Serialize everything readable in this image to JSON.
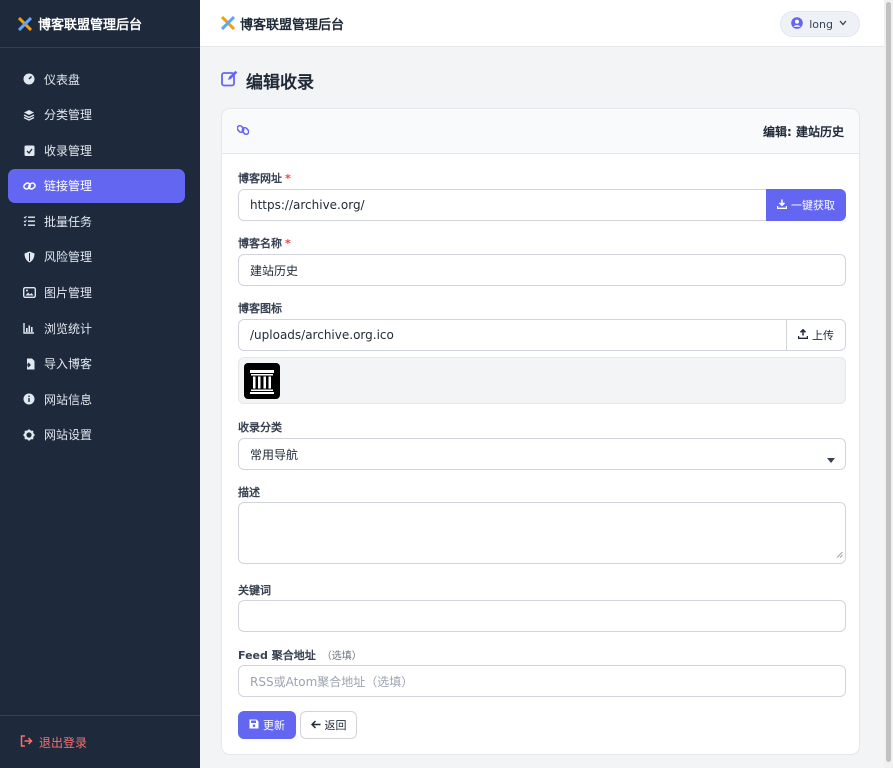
{
  "sidebar": {
    "brand": "博客联盟管理后台",
    "items": [
      {
        "label": "仪表盘",
        "icon": "gauge-icon"
      },
      {
        "label": "分类管理",
        "icon": "layers-icon"
      },
      {
        "label": "收录管理",
        "icon": "clipboard-check-icon"
      },
      {
        "label": "链接管理",
        "icon": "link-icon",
        "active": true
      },
      {
        "label": "批量任务",
        "icon": "list-check-icon"
      },
      {
        "label": "风险管理",
        "icon": "shield-icon"
      },
      {
        "label": "图片管理",
        "icon": "images-icon"
      },
      {
        "label": "浏览统计",
        "icon": "chart-icon"
      },
      {
        "label": "导入博客",
        "icon": "file-import-icon"
      },
      {
        "label": "网站信息",
        "icon": "info-icon"
      },
      {
        "label": "网站设置",
        "icon": "gear-icon"
      }
    ],
    "logout": "退出登录"
  },
  "topbar": {
    "title": "博客联盟管理后台",
    "user": "long"
  },
  "page": {
    "title": "编辑收录"
  },
  "card": {
    "header_right": "编辑: 建站历史"
  },
  "form": {
    "url_label": "博客网址",
    "url_value": "https://archive.org/",
    "fetch_button": "一键获取",
    "name_label": "博客名称",
    "name_value": "建站历史",
    "icon_label": "博客图标",
    "icon_value": "/uploads/archive.org.ico",
    "upload_button": "上传",
    "category_label": "收录分类",
    "category_value": "常用导航",
    "desc_label": "描述",
    "desc_value": "",
    "keywords_label": "关键词",
    "keywords_value": "",
    "feed_label": "Feed 聚合地址",
    "feed_optional": "（选填）",
    "feed_placeholder": "RSS或Atom聚合地址（选填）",
    "required_mark": "*",
    "update_button": "更新",
    "back_button": "返回"
  },
  "colors": {
    "accent": "#6366f1",
    "sidebar_bg": "#1e293b",
    "danger": "#ef4444"
  }
}
